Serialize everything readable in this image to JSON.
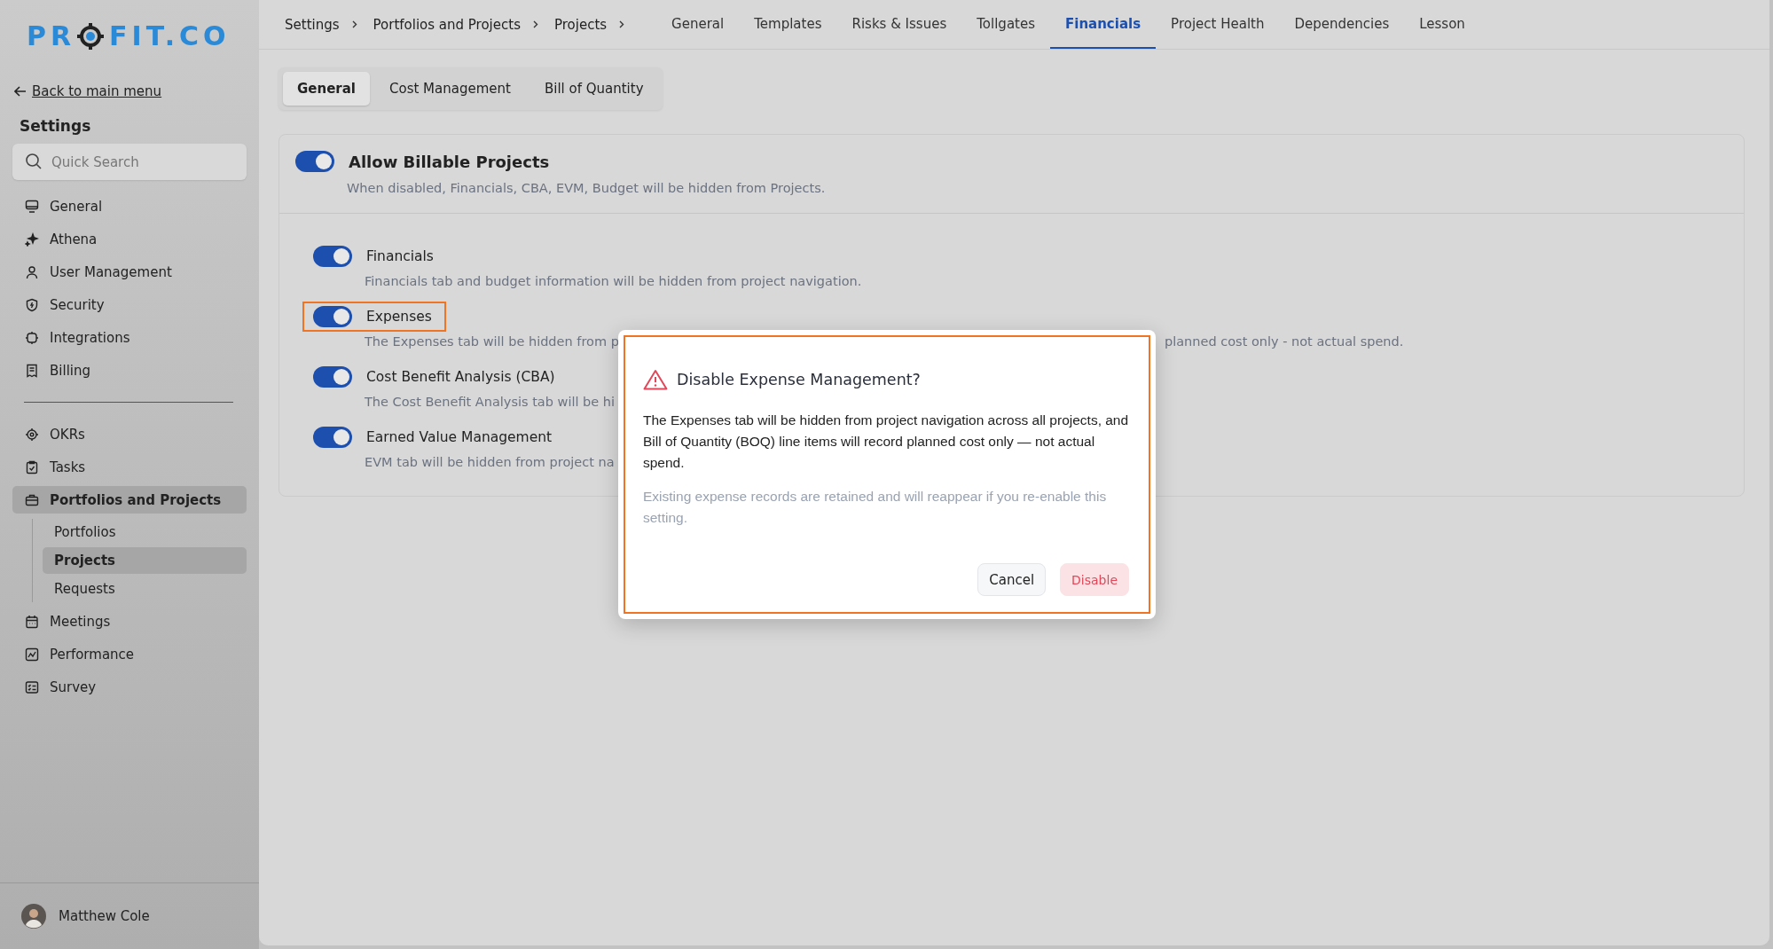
{
  "logo": {
    "text_start": "PR",
    "text_end": "FIT.CO"
  },
  "sidebar": {
    "back_link": "Back to main menu",
    "title": "Settings",
    "search": {
      "placeholder": "Quick Search"
    },
    "groups": [
      [
        {
          "label": "General",
          "selected": false
        },
        {
          "label": "Athena",
          "selected": false
        },
        {
          "label": "User Management",
          "selected": false
        },
        {
          "label": "Security",
          "selected": false
        },
        {
          "label": "Integrations",
          "selected": false
        },
        {
          "label": "Billing",
          "selected": false
        }
      ],
      [
        {
          "label": "OKRs",
          "selected": false
        },
        {
          "label": "Tasks",
          "selected": false
        },
        {
          "label": "Portfolios and Projects",
          "selected": true,
          "expanded": true,
          "children": [
            {
              "label": "Portfolios",
              "selected": false
            },
            {
              "label": "Projects",
              "selected": true
            },
            {
              "label": "Requests",
              "selected": false
            }
          ]
        },
        {
          "label": "Meetings",
          "selected": false
        },
        {
          "label": "Performance",
          "selected": false
        },
        {
          "label": "Survey",
          "selected": false
        }
      ]
    ],
    "user": {
      "name": "Matthew Cole"
    }
  },
  "breadcrumbs": [
    "Settings",
    "Portfolios and Projects",
    "Projects"
  ],
  "tabs": [
    {
      "label": "General",
      "selected": false
    },
    {
      "label": "Templates",
      "selected": false
    },
    {
      "label": "Risks & Issues",
      "selected": false
    },
    {
      "label": "Tollgates",
      "selected": false
    },
    {
      "label": "Financials",
      "selected": true
    },
    {
      "label": "Project Health",
      "selected": false
    },
    {
      "label": "Dependencies",
      "selected": false
    },
    {
      "label": "Lesson",
      "selected": false
    }
  ],
  "subtabs": [
    {
      "label": "General",
      "selected": true
    },
    {
      "label": "Cost Management",
      "selected": false
    },
    {
      "label": "Bill of Quantity",
      "selected": false
    }
  ],
  "master_setting": {
    "label": "Allow Billable Projects",
    "description": "When disabled, Financials, CBA, EVM, Budget will be hidden from Projects.",
    "on": true
  },
  "settings": [
    {
      "label": "Financials",
      "on": true,
      "highlighted": false,
      "description_parts": [
        "Financials tab and budget information will be hidden from project navigation."
      ]
    },
    {
      "label": "Expenses",
      "on": true,
      "highlighted": true,
      "description_parts": [
        "The Expenses tab will be hidden from p",
        "planned cost only - not actual spend."
      ]
    },
    {
      "label": "Cost Benefit Analysis (CBA)",
      "on": true,
      "highlighted": false,
      "description_parts": [
        "The Cost Benefit Analysis tab will be hi"
      ]
    },
    {
      "label": "Earned Value Management",
      "on": true,
      "highlighted": false,
      "description_parts": [
        "EVM tab will be hidden from project na"
      ]
    }
  ],
  "dialog": {
    "title": "Disable Expense Management?",
    "highlighted": true,
    "message": "The Expenses tab will be hidden from project navigation across all projects, and Bill of Quantity (BOQ) line items will record planned cost only — not actual spend.",
    "note": "Existing expense records are retained and will reappear if you re-enable this setting.",
    "buttons": [
      {
        "label": "Cancel",
        "kind": "secondary"
      },
      {
        "label": "Disable",
        "kind": "danger"
      }
    ]
  }
}
